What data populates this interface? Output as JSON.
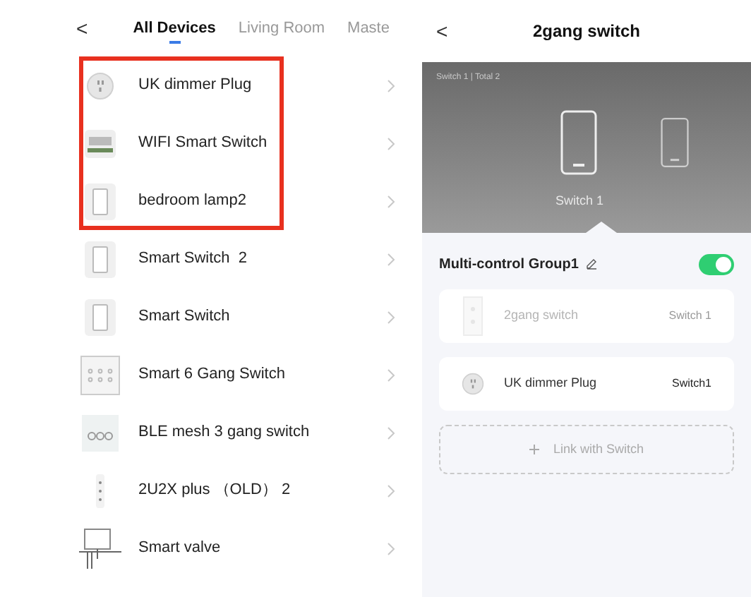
{
  "left": {
    "back": "<",
    "tabs": [
      {
        "label": "All Devices",
        "selected": true
      },
      {
        "label": "Living Room",
        "selected": false
      },
      {
        "label": "Maste",
        "selected": false
      }
    ],
    "devices": [
      {
        "name": "UK dimmer Plug",
        "kind": "plug",
        "highlighted": true
      },
      {
        "name": "WIFI Smart Switch",
        "kind": "board",
        "highlighted": true
      },
      {
        "name": "bedroom lamp2",
        "kind": "switch",
        "highlighted": true
      },
      {
        "name": "Smart Switch  2",
        "kind": "switch",
        "highlighted": false
      },
      {
        "name": "Smart Switch",
        "kind": "switch",
        "highlighted": false
      },
      {
        "name": "Smart 6 Gang Switch",
        "kind": "panel",
        "highlighted": false
      },
      {
        "name": "BLE mesh 3 gang switch",
        "kind": "gang",
        "highlighted": false
      },
      {
        "name": "2U2X plus （OLD） 2",
        "kind": "remote",
        "highlighted": false
      },
      {
        "name": "Smart valve",
        "kind": "valve",
        "highlighted": false
      }
    ]
  },
  "right": {
    "back": "<",
    "title": "2gang switch",
    "counter": "Switch 1 | Total 2",
    "switches": [
      {
        "label": "Switch 1",
        "selected": true
      },
      {
        "selected": false
      }
    ],
    "group": {
      "name": "Multi-control Group1",
      "on": true
    },
    "members": [
      {
        "name": "2gang switch",
        "channel": "Switch 1",
        "kind": "double",
        "disabled": true
      },
      {
        "name": "UK dimmer Plug",
        "channel": "Switch1",
        "kind": "plug",
        "disabled": false
      }
    ],
    "link_button": "Link with Switch"
  }
}
